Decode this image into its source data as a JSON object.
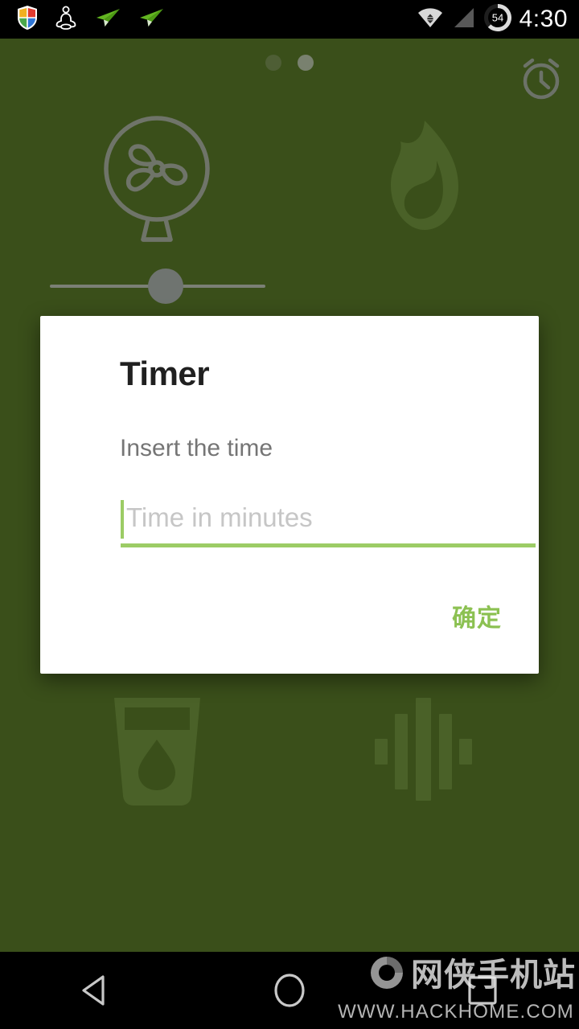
{
  "status_bar": {
    "icons_left": [
      {
        "name": "shield-icon",
        "label": "security-shield"
      },
      {
        "name": "meditation-icon",
        "label": "meditation"
      },
      {
        "name": "paper-plane-icon-1",
        "label": "paper-plane"
      },
      {
        "name": "paper-plane-icon-2",
        "label": "paper-plane"
      }
    ],
    "wifi": "wifi-icon",
    "signal": "signal-icon",
    "battery_level": "54",
    "time": "4:30"
  },
  "home": {
    "page_dots": [
      {
        "state": "inactive"
      },
      {
        "state": "active"
      }
    ],
    "alarm": "alarm-clock-icon",
    "tiles": [
      {
        "name": "fan-icon",
        "label": "Fan"
      },
      {
        "name": "flame-icon",
        "label": "Flame"
      },
      {
        "name": "water-glass-icon",
        "label": "Water"
      },
      {
        "name": "sound-wave-icon",
        "label": "Sound"
      }
    ],
    "slider": {
      "name": "intensity-slider",
      "value_percent": "50"
    }
  },
  "dialog": {
    "title": "Timer",
    "message": "Insert the time",
    "input": {
      "value": "",
      "placeholder": "Time in minutes"
    },
    "confirm_label": "确定",
    "accent_color": "#9ccc65"
  },
  "nav_bar": {
    "back": "back-triangle-icon",
    "home": "home-circle-icon",
    "recents": "recents-square-icon"
  },
  "watermark": {
    "site_cn": "网侠手机站",
    "site_url": "WWW.HACKHOME.COM"
  },
  "colors": {
    "background": "#3a4f1a",
    "accent_green": "#9ccc65",
    "dialog_bg": "#ffffff"
  }
}
